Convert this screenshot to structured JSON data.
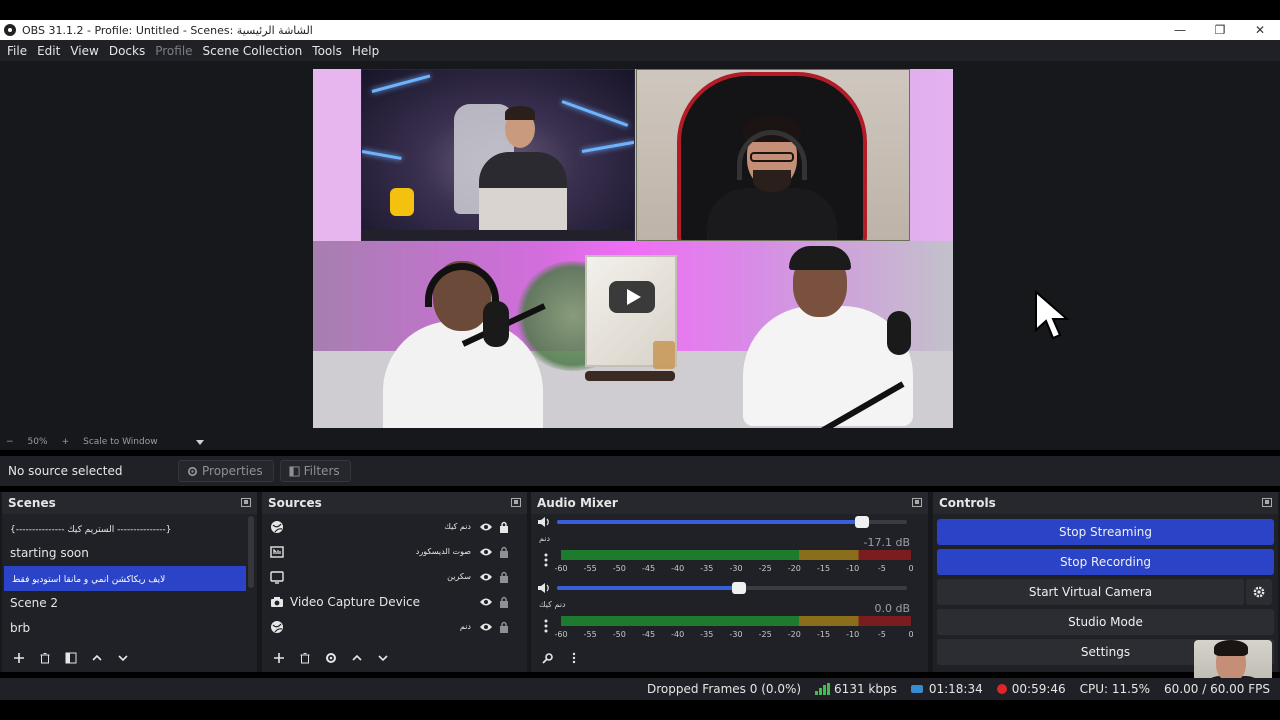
{
  "window": {
    "title": "OBS 31.1.2 - Profile: Untitled - Scenes: الشاشة الرئيسية",
    "minimize_label": "—",
    "restore_label": "❐",
    "close_label": "✕"
  },
  "menu": {
    "file": "File",
    "edit": "Edit",
    "view": "View",
    "docks": "Docks",
    "profile": "Profile",
    "scene_collection": "Scene Collection",
    "tools": "Tools",
    "help": "Help"
  },
  "zoom": {
    "minus": "−",
    "value": "50%",
    "plus": "+",
    "mode": "Scale to Window"
  },
  "source_bar": {
    "no_source": "No source selected",
    "properties": "Properties",
    "filters": "Filters"
  },
  "scenes": {
    "title": "Scenes",
    "items": [
      {
        "label": "{--------------- الستريم كيك ---------------}"
      },
      {
        "label": "starting soon"
      },
      {
        "label": "لايف ريكاكشن انمي و مانقا  استوديو فقط"
      },
      {
        "label": "Scene 2"
      },
      {
        "label": "brb"
      }
    ],
    "selected_index": 2
  },
  "sources": {
    "title": "Sources",
    "items": [
      {
        "label": "دنم كيك",
        "icon": "browser-source-icon"
      },
      {
        "label": "صوت الديسكورد",
        "icon": "audio-output-icon"
      },
      {
        "label": "سكرين",
        "icon": "display-capture-icon"
      },
      {
        "label": "Video Capture Device",
        "icon": "camera-icon"
      },
      {
        "label": "دنم",
        "icon": "browser-source-icon"
      }
    ]
  },
  "mixer": {
    "title": "Audio Mixer",
    "channels": [
      {
        "name": "دنم",
        "db": "-17.1 dB",
        "volume_percent": 87,
        "meter_peak_percent": 0
      },
      {
        "name": "دنم كيك",
        "db": "0.0 dB",
        "volume_percent": 52,
        "meter_peak_percent": 0
      }
    ],
    "scale": [
      "-60",
      "-55",
      "-50",
      "-45",
      "-40",
      "-35",
      "-30",
      "-25",
      "-20",
      "-15",
      "-10",
      "-5",
      "0"
    ]
  },
  "controls": {
    "title": "Controls",
    "stop_streaming": "Stop Streaming",
    "stop_recording": "Stop Recording",
    "start_virtual_camera": "Start Virtual Camera",
    "studio_mode": "Studio Mode",
    "settings": "Settings"
  },
  "status": {
    "dropped_frames": "Dropped Frames 0 (0.0%)",
    "bitrate": "6131 kbps",
    "stream_time": "01:18:34",
    "record_time": "00:59:46",
    "cpu": "CPU: 11.5%",
    "fps": "60.00 / 60.00 FPS"
  },
  "colors": {
    "accent": "#2a43c7",
    "meter_green": "#3ec149",
    "meter_yellow": "#d8b12e",
    "meter_red": "#d2333a",
    "record_red": "#e0242c"
  }
}
